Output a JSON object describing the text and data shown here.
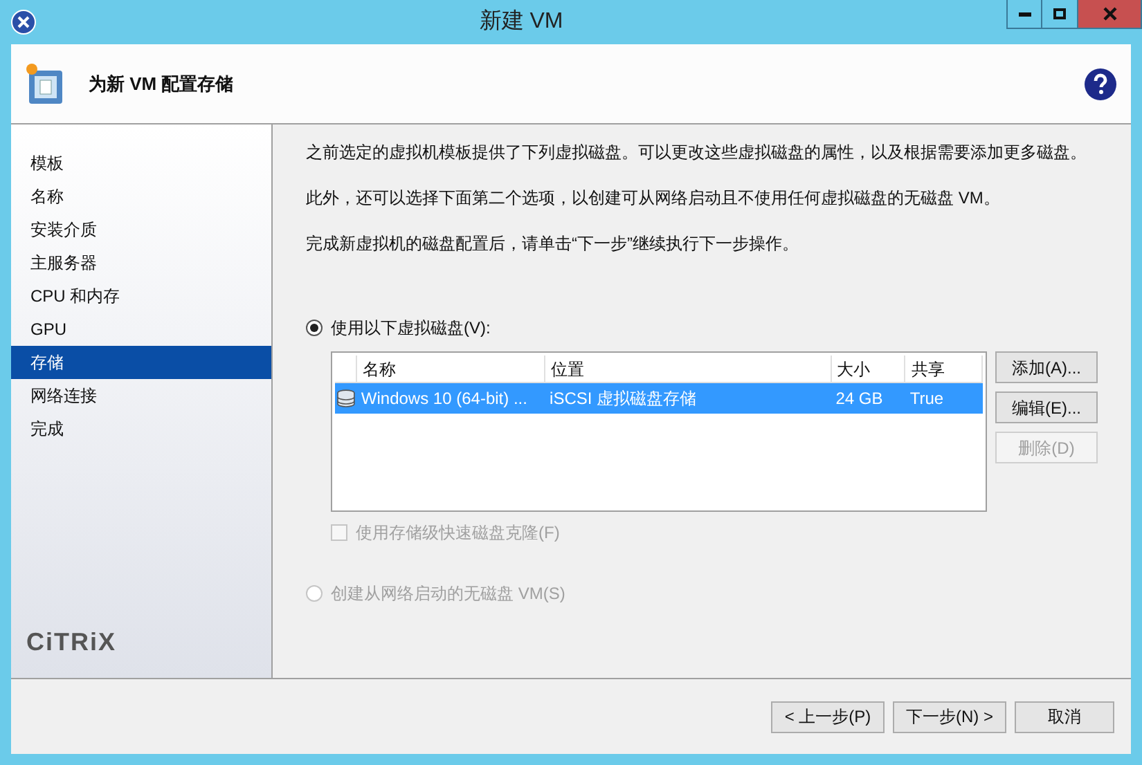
{
  "window": {
    "title": "新建 VM"
  },
  "header": {
    "title": "为新 VM 配置存储"
  },
  "sidebar": {
    "items": [
      {
        "label": "模板",
        "selected": false
      },
      {
        "label": "名称",
        "selected": false
      },
      {
        "label": "安装介质",
        "selected": false
      },
      {
        "label": "主服务器",
        "selected": false
      },
      {
        "label": "CPU 和内存",
        "selected": false
      },
      {
        "label": "GPU",
        "selected": false
      },
      {
        "label": "存储",
        "selected": true
      },
      {
        "label": "网络连接",
        "selected": false
      },
      {
        "label": "完成",
        "selected": false
      }
    ],
    "logo": "CiTRiX"
  },
  "paragraphs": [
    "之前选定的虚拟机模板提供了下列虚拟磁盘。可以更改这些虚拟磁盘的属性，以及根据需要添加更多磁盘。",
    "此外，还可以选择下面第二个选项，以创建可从网络启动且不使用任何虚拟磁盘的无磁盘 VM。",
    "完成新虚拟机的磁盘配置后，请单击“下一步”继续执行下一步操作。"
  ],
  "options": [
    {
      "label": "使用以下虚拟磁盘(V):",
      "selected": true,
      "disabled": false
    },
    {
      "label": "创建从网络启动的无磁盘 VM(S)",
      "selected": false,
      "disabled": true
    }
  ],
  "table": {
    "columns": [
      "名称",
      "位置",
      "大小",
      "共享"
    ],
    "rows": [
      {
        "cells": [
          "Windows 10 (64-bit) ...",
          "iSCSI 虚拟磁盘存储",
          "24 GB",
          "True"
        ],
        "selected": true
      }
    ]
  },
  "disk_buttons": [
    {
      "label": "添加(A)...",
      "disabled": false
    },
    {
      "label": "编辑(E)...",
      "disabled": false
    },
    {
      "label": "删除(D)",
      "disabled": true
    }
  ],
  "fast_clone": {
    "label": "使用存储级快速磁盘克隆(F)",
    "checked": false,
    "disabled": true
  },
  "footer_buttons": [
    {
      "label": "< 上一步(P)",
      "disabled": false
    },
    {
      "label": "下一步(N) >",
      "disabled": false
    },
    {
      "label": "取消",
      "disabled": false
    }
  ]
}
